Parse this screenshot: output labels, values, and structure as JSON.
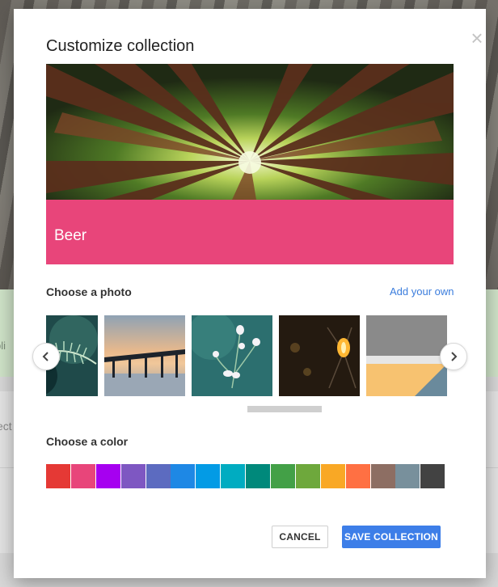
{
  "background": {
    "band_fragment": "bli",
    "lower_fragment": "ect"
  },
  "modal": {
    "title": "Customize collection",
    "close_icon": "close-icon",
    "collection_name": "Beer",
    "selected_color": "#e8457a",
    "photo_section": {
      "label": "Choose a photo",
      "add_link": "Add your own",
      "thumbnails": [
        "fern-leaf-photo",
        "bay-bridge-sunset-photo",
        "white-buds-photo",
        "edison-bulb-photo",
        "gray-yellow-abstract-photo"
      ]
    },
    "color_section": {
      "label": "Choose a color",
      "colors": [
        "#e53935",
        "#e8457a",
        "#a600f0",
        "#7e57c2",
        "#5c6bc0",
        "#1e88e5",
        "#039be5",
        "#00acc1",
        "#00897b",
        "#43a047",
        "#6ea83c",
        "#f9a825",
        "#ff7043",
        "#8d6e63",
        "#78909c",
        "#424242"
      ]
    },
    "buttons": {
      "cancel": "CANCEL",
      "save": "SAVE COLLECTION"
    }
  }
}
